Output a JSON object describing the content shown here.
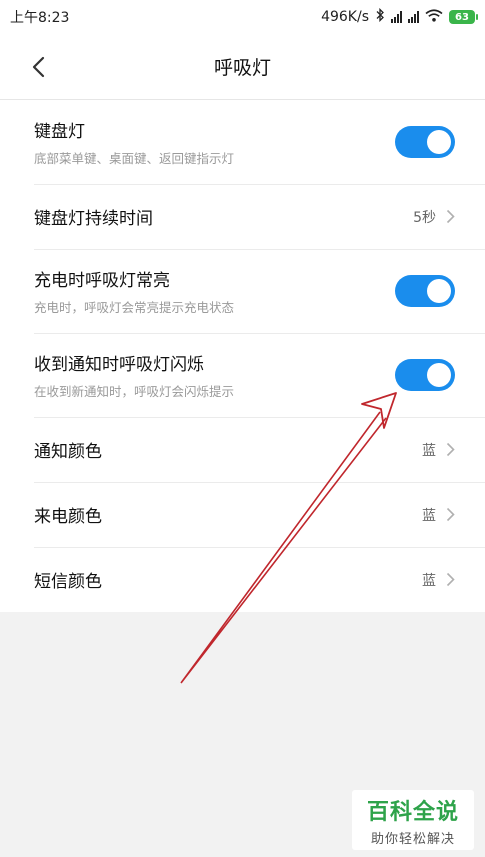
{
  "status_bar": {
    "time": "上午8:23",
    "network_speed": "496K/s",
    "battery": "63",
    "icons": [
      "bluetooth-icon",
      "signal-icon",
      "wifi-icon",
      "battery-icon"
    ]
  },
  "header": {
    "title": "呼吸灯",
    "back_icon": "chevron-left-icon"
  },
  "settings": [
    {
      "title": "键盘灯",
      "desc": "底部菜单键、桌面键、返回键指示灯",
      "type": "toggle",
      "on": true
    },
    {
      "title": "键盘灯持续时间",
      "value": "5秒",
      "type": "link"
    },
    {
      "title": "充电时呼吸灯常亮",
      "desc": "充电时，呼吸灯会常亮提示充电状态",
      "type": "toggle",
      "on": true
    },
    {
      "title": "收到通知时呼吸灯闪烁",
      "desc": "在收到新通知时，呼吸灯会闪烁提示",
      "type": "toggle",
      "on": true
    },
    {
      "title": "通知颜色",
      "value": "蓝",
      "type": "link"
    },
    {
      "title": "来电颜色",
      "value": "蓝",
      "type": "link"
    },
    {
      "title": "短信颜色",
      "value": "蓝",
      "type": "link"
    }
  ],
  "watermark": {
    "title": "百科全说",
    "subtitle": "助你轻松解决"
  },
  "colors": {
    "toggle_on": "#1a8ded",
    "annotation_arrow": "#c0272d",
    "watermark_green": "#2ea34a"
  }
}
